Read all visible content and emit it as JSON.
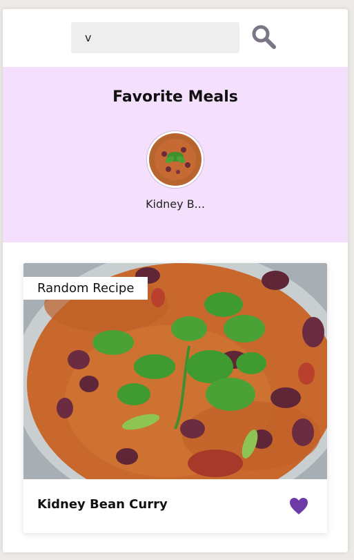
{
  "search": {
    "value": "v",
    "placeholder": ""
  },
  "favorites": {
    "title": "Favorite Meals",
    "items": [
      {
        "name": "Kidney B..."
      }
    ]
  },
  "meal": {
    "tag": "Random Recipe",
    "name": "Kidney Bean Curry",
    "liked": true
  },
  "icons": {
    "search": "search-icon",
    "heart": "heart-icon"
  },
  "colors": {
    "accent": "#6d3aa8",
    "favorites_bg": "#f4dffd",
    "search_icon": "#7c7585"
  }
}
